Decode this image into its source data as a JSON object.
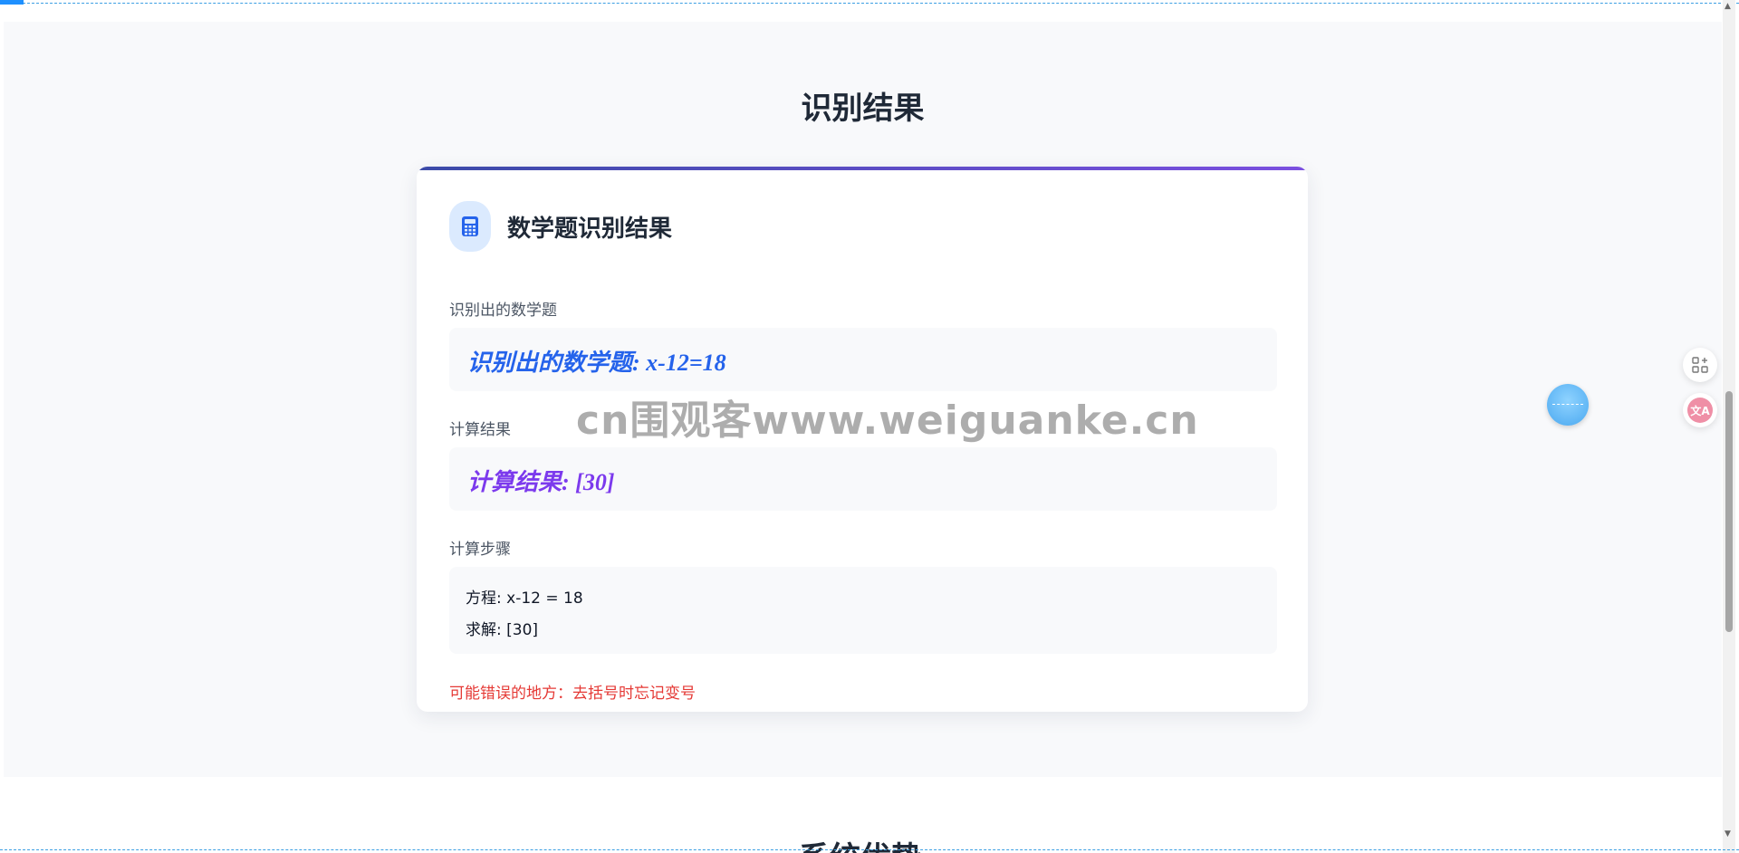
{
  "results_section": {
    "title": "识别结果",
    "card": {
      "title": "数学题识别结果",
      "icon": "calculator-icon",
      "recognized_label": "识别出的数学题",
      "recognized_value": "识别出的数学题: x-12=18",
      "result_label": "计算结果",
      "result_value": "计算结果: [30]",
      "steps_label": "计算步骤",
      "steps": [
        "方程: x-12 = 18",
        "求解: [30]"
      ],
      "error_note": "可能错误的地方：去括号时忘记变号"
    }
  },
  "watermark": "cn围观客www.weiguanke.cn",
  "side_tools": {
    "apps_icon": "apps-add-icon",
    "translate_icon": "translate-icon",
    "translate_text": "文A"
  },
  "next_section": {
    "title": "系统优势"
  },
  "colors": {
    "accent_gradient_start": "#3b4aa8",
    "accent_gradient_end": "#7b4fe0",
    "recognized_text": "#2563eb",
    "result_text": "#7c3aed",
    "error_text": "#e53935"
  }
}
